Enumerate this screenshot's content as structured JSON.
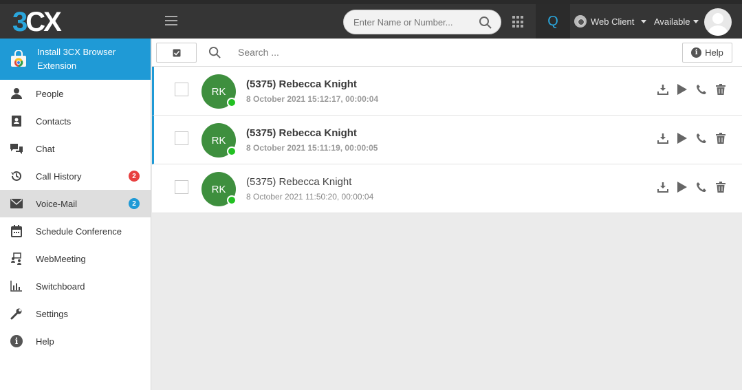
{
  "app": {
    "logo_a": "3",
    "logo_b": "CX",
    "search_placeholder": "Enter Name or Number...",
    "q_label": "Q",
    "web_client_label": "Web Client",
    "status_label": "Available"
  },
  "sidebar": {
    "extension_banner": "Install 3CX Browser Extension",
    "items": [
      {
        "label": "People",
        "icon": "person-icon"
      },
      {
        "label": "Contacts",
        "icon": "contacts-book-icon"
      },
      {
        "label": "Chat",
        "icon": "chat-bubbles-icon"
      },
      {
        "label": "Call History",
        "icon": "history-clock-icon",
        "badge": "2"
      },
      {
        "label": "Voice-Mail",
        "icon": "envelope-icon",
        "badge": "2"
      },
      {
        "label": "Schedule Conference",
        "icon": "calendar-icon"
      },
      {
        "label": "WebMeeting",
        "icon": "web-meeting-icon"
      },
      {
        "label": "Switchboard",
        "icon": "bar-chart-icon"
      },
      {
        "label": "Settings",
        "icon": "wrench-icon"
      },
      {
        "label": "Help",
        "icon": "info-icon"
      }
    ]
  },
  "toolbar": {
    "search_placeholder": "Search ...",
    "help_label": "Help"
  },
  "voicemails": [
    {
      "initials": "RK",
      "name": "(5375) Rebecca Knight",
      "meta": "8 October 2021 15:12:17, 00:00:04",
      "unread": true
    },
    {
      "initials": "RK",
      "name": "(5375) Rebecca Knight",
      "meta": "8 October 2021 15:11:19, 00:00:05",
      "unread": true
    },
    {
      "initials": "RK",
      "name": "(5375) Rebecca Knight",
      "meta": "8 October 2021 11:50:20, 00:00:04",
      "unread": false
    }
  ],
  "colors": {
    "accent": "#1f9ad6",
    "topbar": "#353535",
    "avatar_green": "#3e8f3e",
    "online_green": "#22c022",
    "badge_red": "#e84040"
  }
}
